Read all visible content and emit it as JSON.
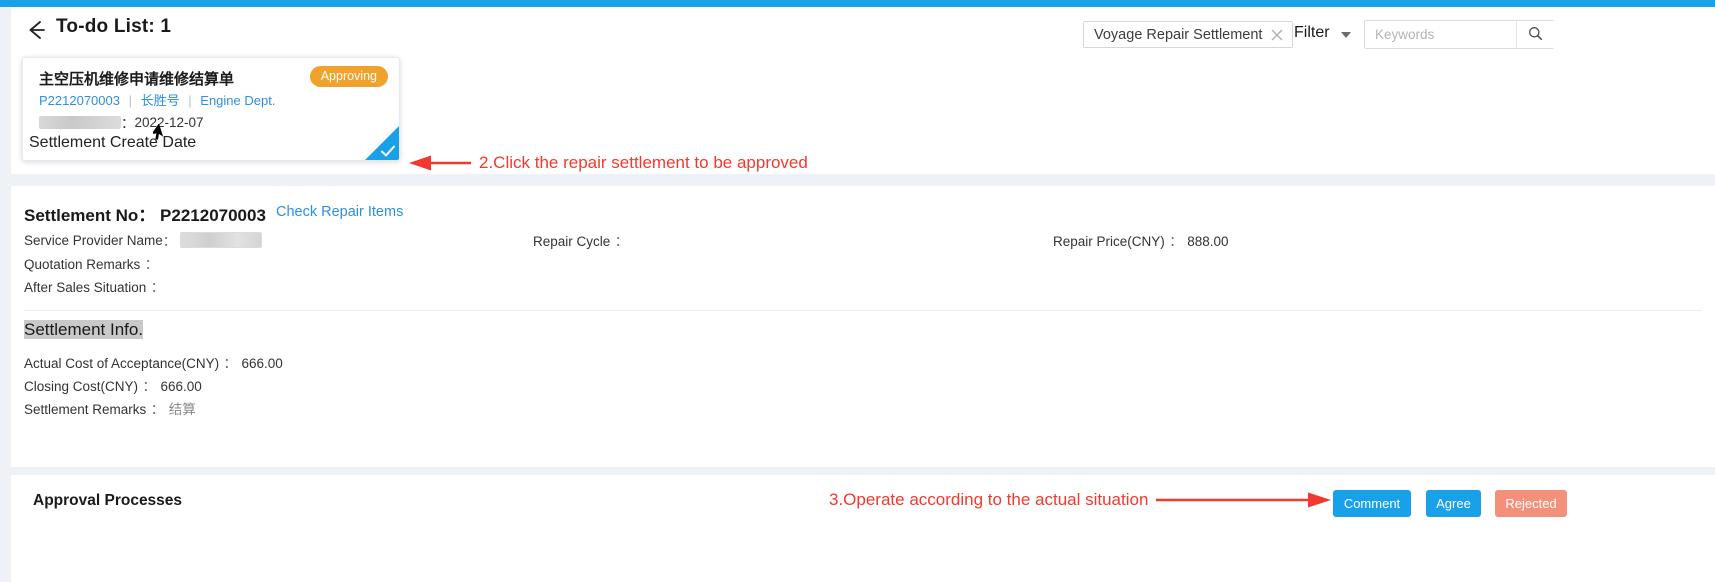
{
  "header": {
    "back_icon": "back-arrow-icon",
    "title": "To-do List: 1",
    "filter_tag": "Voyage Repair Settlement",
    "filter_tag_close_icon": "close-icon",
    "filter_label": "Filter",
    "filter_caret_icon": "chevron-down-icon",
    "search_placeholder": "Keywords",
    "search_value": "",
    "search_icon": "search-icon"
  },
  "todo_card": {
    "title": "主空压机维修申请维修结算单",
    "badge": "Approving",
    "meta_code": "P2212070003",
    "meta_vessel": "长胜号",
    "meta_dept": "Engine Dept.",
    "meta_separator": "|",
    "date_label_redacted": "",
    "date_colon": "：",
    "date_value": "2022-12-07",
    "footer_label": "Settlement Create Date",
    "selected_check_icon": "check-icon",
    "cursor_icon": "cursor-arrow-icon"
  },
  "annotations": {
    "step2": "2.Click the repair settlement to be approved",
    "step3": "3.Operate according to the actual situation",
    "arrow_color": "#f2392e"
  },
  "detail": {
    "settlement_no_label": "Settlement No：",
    "settlement_no_value": "P2212070003",
    "check_repair_items": "Check Repair Items",
    "service_provider_label": "Service Provider Name",
    "service_provider_value": "",
    "quotation_remarks_label": "Quotation Remarks",
    "quotation_remarks_value": "",
    "after_sales_label": "After Sales Situation",
    "after_sales_value": "",
    "repair_cycle_label": "Repair Cycle",
    "repair_cycle_value": "",
    "repair_price_label": "Repair Price(CNY)",
    "repair_price_value": "888.00",
    "colon": "：",
    "section_title": "Settlement Info.",
    "actual_cost_label": "Actual Cost of Acceptance(CNY)",
    "actual_cost_value": "666.00",
    "closing_cost_label": "Closing Cost(CNY)",
    "closing_cost_value": "666.00",
    "settlement_remarks_label": "Settlement Remarks",
    "settlement_remarks_value": "结算"
  },
  "footer": {
    "approval_title": "Approval Processes",
    "comment_button": "Comment",
    "agree_button": "Agree",
    "rejected_button": "Rejected"
  },
  "colors": {
    "accent_blue": "#18a0e8",
    "link_blue": "#2f8fe0",
    "badge_orange": "#f0a22c",
    "reject_salmon": "#f3907a",
    "annotation_red": "#f2392e"
  }
}
